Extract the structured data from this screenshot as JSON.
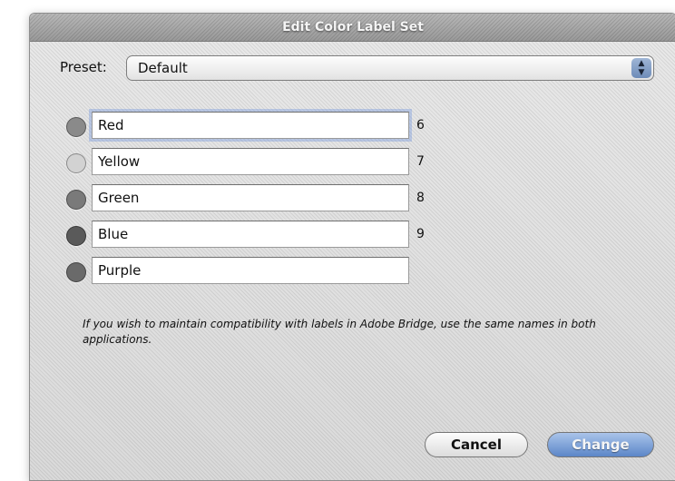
{
  "dialog": {
    "title": "Edit Color Label Set",
    "preset_label": "Preset:",
    "preset_value": "Default",
    "labels": [
      {
        "name": "Red",
        "shortcut": "6",
        "color": "#8a8a8a"
      },
      {
        "name": "Yellow",
        "shortcut": "7",
        "color": "#d2d2d2"
      },
      {
        "name": "Green",
        "shortcut": "8",
        "color": "#7a7a7a"
      },
      {
        "name": "Blue",
        "shortcut": "9",
        "color": "#5a5a5a"
      },
      {
        "name": "Purple",
        "shortcut": "",
        "color": "#6a6a6a"
      }
    ],
    "note": "If you wish to maintain compatibility with labels in Adobe Bridge, use the same names in both applications.",
    "cancel_label": "Cancel",
    "change_label": "Change"
  }
}
